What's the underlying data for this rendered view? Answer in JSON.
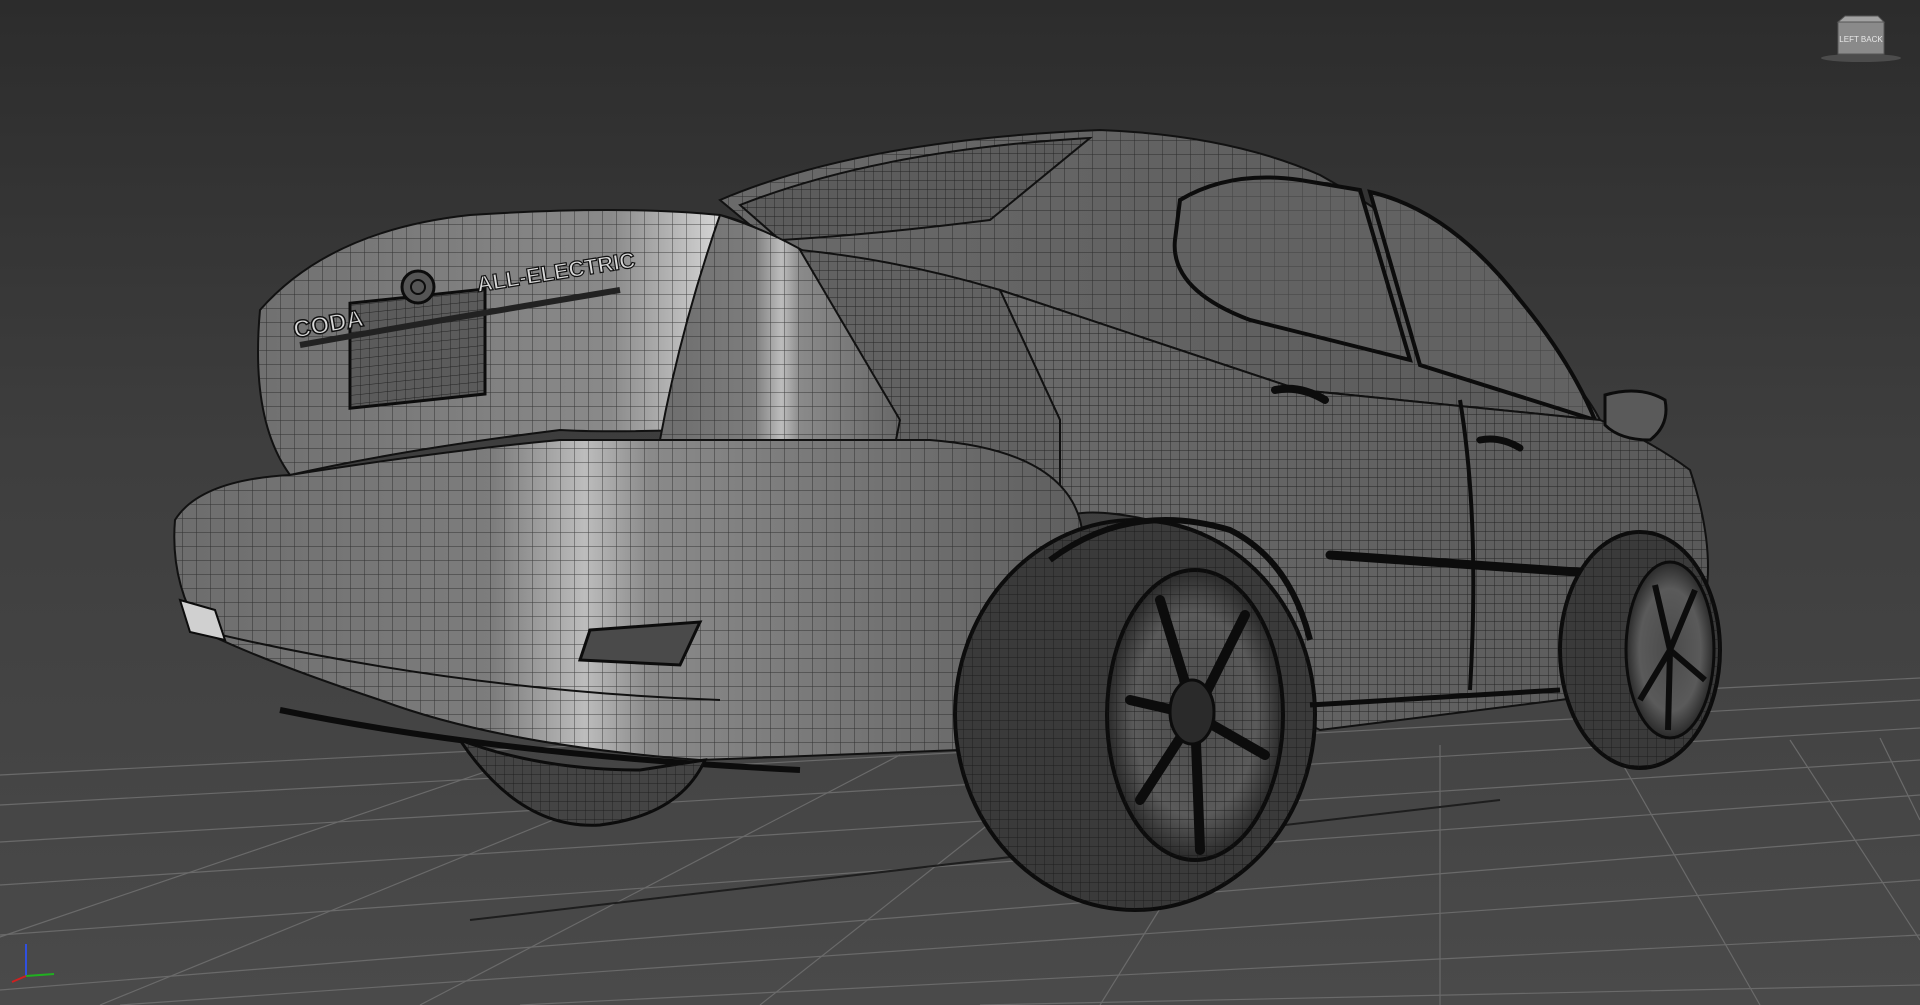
{
  "viewport": {
    "viewcube_label": "LEFT  BACK"
  },
  "car": {
    "brand_badge": "CODA",
    "model_badge": "ALL-ELECTRIC"
  },
  "colors": {
    "background_top": "#2c2c2c",
    "background_bottom": "#4a4a4a",
    "grid_line": "#6a6a6a",
    "wire": "#1a1a1a",
    "axis_x": "#d02020",
    "axis_y": "#20b020",
    "axis_z": "#3050e0"
  },
  "icons": {
    "viewcube": "viewcube-icon",
    "axis_tripod": "axis-tripod-icon"
  }
}
